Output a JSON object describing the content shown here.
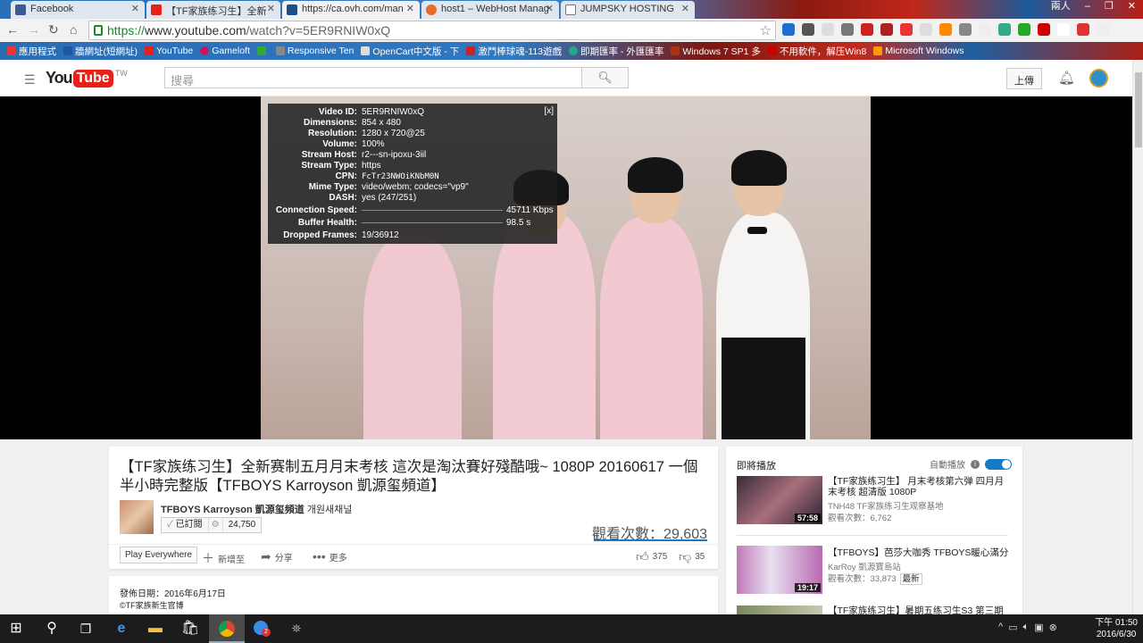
{
  "browser": {
    "tabs": [
      {
        "label": "Facebook",
        "color": "#3b5998"
      },
      {
        "label": "【TF家族练习生】全新",
        "color": "#e62117"
      },
      {
        "label": "https://ca.ovh.com/man",
        "color": "#1a4f8a"
      },
      {
        "label": "host1 – WebHost Manag",
        "color": "#e86a2a"
      },
      {
        "label": "JUMPSKY HOSTING",
        "color": "#777777"
      }
    ],
    "window_user": "兩人",
    "url_proto": "https://",
    "url_host": "www.youtube.com",
    "url_path": "/watch?v=5ER9RNIW0xQ",
    "bookmarks": [
      "應用程式",
      "牆網址(短網址)",
      "YouTube",
      "Gameloft",
      "",
      "Responsive Ten",
      "OpenCart中文版 - 下",
      "激鬥棒球魂-113遊戲",
      "即期匯率 - 外匯匯率",
      "Windows 7 SP1 多",
      "不用軟件，解压Win8",
      "Microsoft Windows"
    ]
  },
  "youtube": {
    "logo_you": "You",
    "logo_tube": "Tube",
    "region": "TW",
    "search_placeholder": "搜尋",
    "upload_label": "上傳",
    "video": {
      "title": "【TF家族练习生】全新赛制五月月末考核 這次是淘汰賽好殘酷哦~ 1080P 20160617 一個半小時完整版【TFBOYS Karroyson 凱源玺頻道】",
      "channel": "TFBOYS Karroyson 凱源玺頻道",
      "channel_suffix": "개원새채널",
      "subscribe_label": "已訂閱",
      "subscriber_count": "24,750",
      "views": "觀看次數：29,603",
      "play_everywhere": "Play Everywhere",
      "add_to": "新增至",
      "share": "分享",
      "more": "更多",
      "likes": "375",
      "dislikes": "35",
      "published": "發佈日期：2016年6月17日",
      "desc_line": "©TF家族新生官博"
    },
    "stats": [
      {
        "k": "Video ID:",
        "v": "5ER9RNIW0xQ"
      },
      {
        "k": "Dimensions:",
        "v": "854 x 480"
      },
      {
        "k": "Resolution:",
        "v": "1280 x 720@25"
      },
      {
        "k": "Volume:",
        "v": "100%"
      },
      {
        "k": "Stream Host:",
        "v": "r2---sn-ipoxu-3iil"
      },
      {
        "k": "Stream Type:",
        "v": "https"
      },
      {
        "k": "CPN:",
        "v": "FcTr23NWOiKNbM0N"
      },
      {
        "k": "Mime Type:",
        "v": "video/webm; codecs=\"vp9\""
      },
      {
        "k": "DASH:",
        "v": "yes (247/251)"
      },
      {
        "k": "Connection Speed:",
        "v": "45711 Kbps"
      },
      {
        "k": "Buffer Health:",
        "v": "98.5 s"
      },
      {
        "k": "Dropped Frames:",
        "v": "19/36912"
      }
    ],
    "stats_close": "[x]",
    "sidebar": {
      "upnext": "即將播放",
      "autoplay": "自動播放",
      "items": [
        {
          "title": "【TF家族练习生】 月末考核第六弹 四月月末考核 超清版 1080P",
          "channel": "TNH48 TF家族练习生观察基地",
          "views": "觀看次數：6,762",
          "duration": "57:58",
          "badge": ""
        },
        {
          "title": "【TFBOYS】芭莎大咖秀 TFBOYS暖心滿分",
          "channel": "KarRoy 凱源寶島站",
          "views": "觀看次數：33,873",
          "duration": "19:17",
          "badge": "最新"
        },
        {
          "title": "【TF家族练习生】暑期五练习生S3 第三期",
          "channel": "",
          "views": "",
          "duration": "",
          "badge": ""
        }
      ]
    }
  },
  "taskbar": {
    "time": "下午 01:50",
    "date": "2016/6/30",
    "chrome_badge": "2"
  }
}
